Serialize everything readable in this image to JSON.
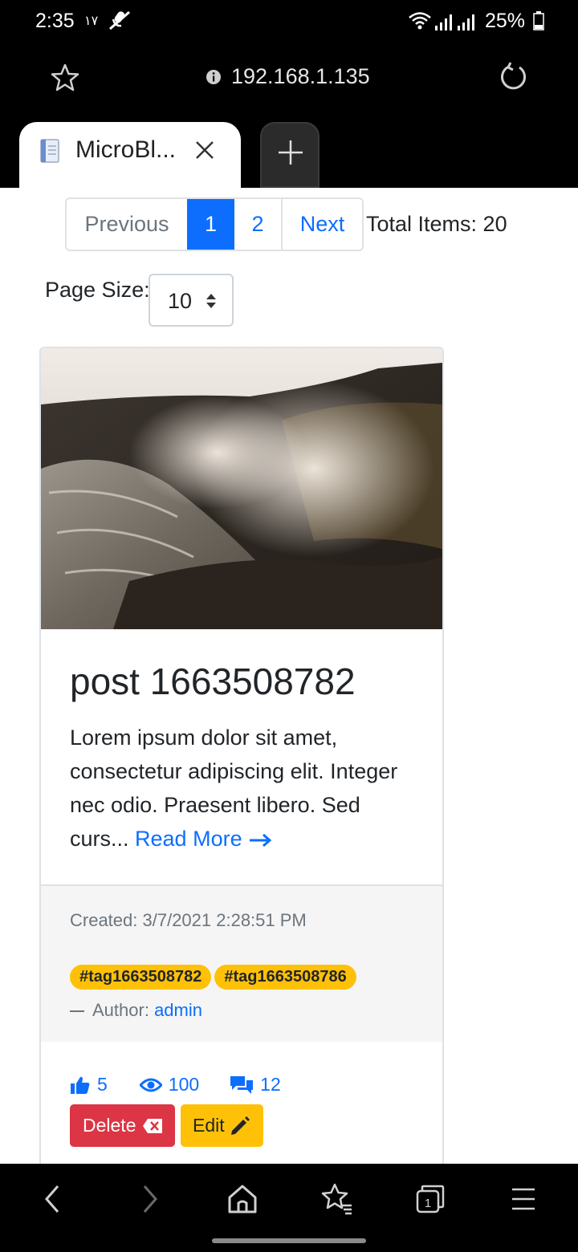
{
  "status_bar": {
    "time": "2:35",
    "extra": "۱۷",
    "battery": "25%"
  },
  "address_bar": {
    "url": "192.168.1.135"
  },
  "tabs": {
    "active_title": "MicroBl..."
  },
  "pagination": {
    "previous_label": "Previous",
    "pages": [
      "1",
      "2"
    ],
    "current_page": "1",
    "next_label": "Next",
    "total_items": "Total Items: 20"
  },
  "page_size": {
    "label": "Page Size:",
    "value": "10"
  },
  "post": {
    "title": "post 1663508782",
    "excerpt": "Lorem ipsum dolor sit amet, consectetur adipiscing elit. Integer nec odio. Praesent libero. Sed curs...",
    "read_more_label": "Read More",
    "created": "Created: 3/7/2021 2:28:51 PM",
    "tags": [
      "#tag1663508782",
      "#tag1663508786"
    ],
    "author_prefix": "Author:",
    "author_name": "admin",
    "likes": "5",
    "views": "100",
    "comments": "12",
    "delete_label": "Delete",
    "edit_label": "Edit"
  },
  "colors": {
    "primary": "#0d6efd",
    "danger": "#dc3545",
    "warning": "#ffc107",
    "muted": "#6c757d"
  }
}
